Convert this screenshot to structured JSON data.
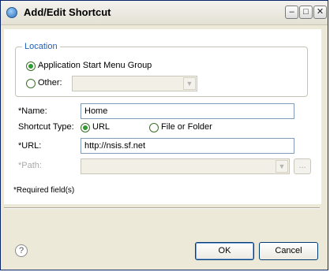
{
  "window": {
    "title": "Add/Edit Shortcut"
  },
  "location_group": {
    "legend": "Location",
    "start_menu_label": "Application Start Menu Group",
    "other_label": "Other:",
    "other_value": ""
  },
  "form": {
    "name_label": "*Name:",
    "name_value": "Home",
    "shortcut_type_label": "Shortcut Type:",
    "type_url_label": "URL",
    "type_file_label": "File or Folder",
    "url_label": "*URL:",
    "url_value": "http://nsis.sf.net",
    "path_label": "*Path:",
    "path_value": "",
    "browse_label": "..."
  },
  "required_note": "*Required field(s)",
  "footer": {
    "help_icon_text": "?",
    "ok_label": "OK",
    "cancel_label": "Cancel"
  },
  "icons": {
    "app": "shortcut-app-icon",
    "minimize": "minimize-icon",
    "maximize": "maximize-icon",
    "close": "close-icon",
    "help": "help-icon",
    "combo_arrow": "chevron-down-icon"
  },
  "colors": {
    "title_border": "#0a246a",
    "dialog_bg": "#ece9d8",
    "legend_text": "#1f5fb8",
    "radio_selected": "#2f9a2f",
    "button_border": "#003c74"
  }
}
